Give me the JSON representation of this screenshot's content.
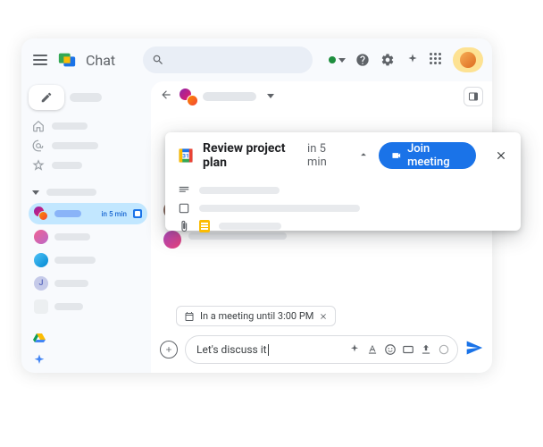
{
  "header": {
    "product_name": "Chat"
  },
  "sidebar": {
    "selected": {
      "time_label": "in 5 min"
    }
  },
  "meeting_card": {
    "title": "Review project plan",
    "time_label": "in 5 min",
    "join_label": "Join meeting"
  },
  "status_chip": {
    "text": "In a meeting until 3:00 PM"
  },
  "compose": {
    "draft_text": "Let's discuss it"
  }
}
